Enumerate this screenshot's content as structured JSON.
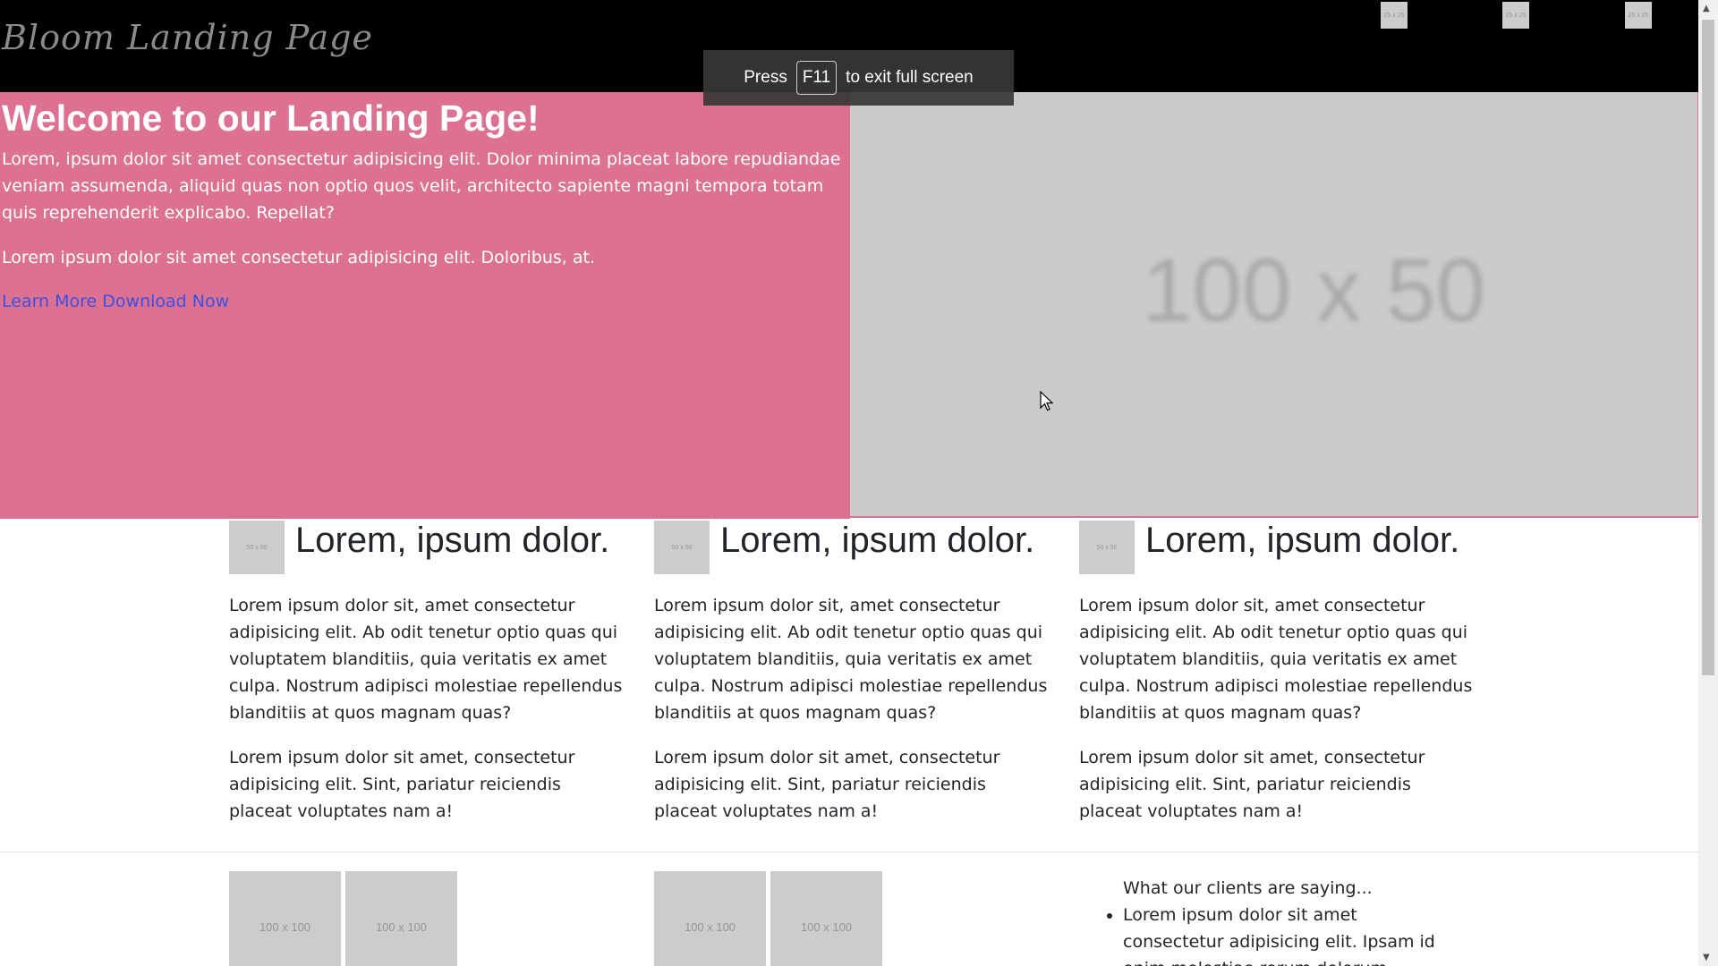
{
  "navbar": {
    "brand": "Bloom Landing Page",
    "thumbs": [
      "25 x 25",
      "25 x 25",
      "25 x 25"
    ]
  },
  "fullscreen_toast": {
    "press": "Press",
    "key": "F11",
    "suffix": "to exit full screen"
  },
  "hero": {
    "title": "Welcome to our Landing Page!",
    "paragraph1": "Lorem, ipsum dolor sit amet consectetur adipisicing elit. Dolor minima placeat labore repudiandae veniam assumenda, aliquid quas non optio quos velit, architecto sapiente magni tempora totam quis reprehenderit explicabo. Repellat?",
    "paragraph2": "Lorem ipsum dolor sit amet consectetur adipisicing elit. Doloribus, at.",
    "link": "Learn More Download Now",
    "image_label": "100 x 50"
  },
  "features": [
    {
      "icon_label": "50 x 50",
      "title": "Lorem, ipsum dolor.",
      "paragraph1": "Lorem ipsum dolor sit, amet consectetur adipisicing elit. Ab odit tenetur optio quas qui voluptatem blanditiis, quia veritatis ex amet culpa. Nostrum adipisci molestiae repellendus blanditiis at quos magnam quas?",
      "paragraph2": "Lorem ipsum dolor sit amet, consectetur adipisicing elit. Sint, pariatur reiciendis placeat voluptates nam a!"
    },
    {
      "icon_label": "50 x 50",
      "title": "Lorem, ipsum dolor.",
      "paragraph1": "Lorem ipsum dolor sit, amet consectetur adipisicing elit. Ab odit tenetur optio quas qui voluptatem blanditiis, quia veritatis ex amet culpa. Nostrum adipisci molestiae repellendus blanditiis at quos magnam quas?",
      "paragraph2": "Lorem ipsum dolor sit amet, consectetur adipisicing elit. Sint, pariatur reiciendis placeat voluptates nam a!"
    },
    {
      "icon_label": "50 x 50",
      "title": "Lorem, ipsum dolor.",
      "paragraph1": "Lorem ipsum dolor sit, amet consectetur adipisicing elit. Ab odit tenetur optio quas qui voluptatem blanditiis, quia veritatis ex amet culpa. Nostrum adipisci molestiae repellendus blanditiis at quos magnam quas?",
      "paragraph2": "Lorem ipsum dolor sit amet, consectetur adipisicing elit. Sint, pariatur reiciendis placeat voluptates nam a!"
    }
  ],
  "gallery": [
    "100 x 100",
    "100 x 100",
    "100 x 100",
    "100 x 100"
  ],
  "testimonials": {
    "heading": "What our clients are saying...",
    "items": [
      "Lorem ipsum dolor sit amet consectetur adipisicing elit. Ipsam id enim molestiae rerum dolorum exercitationem quos"
    ]
  },
  "colors": {
    "navbar_bg": "#000000",
    "hero_bg": "#dd7191",
    "link": "#3b4fe6",
    "placeholder_bg": "#cccccc"
  }
}
